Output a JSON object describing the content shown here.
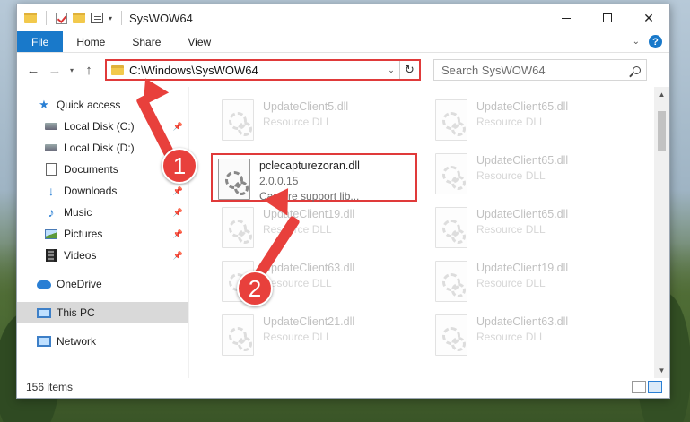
{
  "window": {
    "title": "SysWOW64",
    "minimize": "—",
    "close": "✕"
  },
  "ribbon": {
    "tabs": [
      "File",
      "Home",
      "Share",
      "View"
    ],
    "help": "?"
  },
  "address": {
    "path": "C:\\Windows\\SysWOW64",
    "search_placeholder": "Search SysWOW64"
  },
  "sidebar": {
    "items": [
      {
        "label": "Quick access"
      },
      {
        "label": "Local Disk (C:)"
      },
      {
        "label": "Local Disk (D:)"
      },
      {
        "label": "Documents"
      },
      {
        "label": "Downloads"
      },
      {
        "label": "Music"
      },
      {
        "label": "Pictures"
      },
      {
        "label": "Videos"
      },
      {
        "label": "OneDrive"
      },
      {
        "label": "This PC"
      },
      {
        "label": "Network"
      }
    ]
  },
  "files": [
    {
      "name": "UpdateClient5.dll",
      "sub": "Resource DLL"
    },
    {
      "name": "UpdateClient65.dll",
      "sub": "Resource DLL"
    },
    {
      "name": "pclecapturezoran.dll",
      "sub": "2.0.0.15",
      "desc": "Capture support lib..."
    },
    {
      "name": "UpdateClient65.dll",
      "sub": "Resource DLL"
    },
    {
      "name": "UpdateClient19.dll",
      "sub": "Resource DLL"
    },
    {
      "name": "UpdateClient65.dll",
      "sub": "Resource DLL"
    },
    {
      "name": "UpdateClient63.dll",
      "sub": "Resource DLL"
    },
    {
      "name": "UpdateClient19.dll",
      "sub": "Resource DLL"
    },
    {
      "name": "UpdateClient21.dll",
      "sub": "Resource DLL"
    },
    {
      "name": "UpdateClient63.dll",
      "sub": "Resource DLL"
    }
  ],
  "status": {
    "count": "156 items"
  },
  "annotations": {
    "step1": "1",
    "step2": "2",
    "color": "#e8403c"
  }
}
